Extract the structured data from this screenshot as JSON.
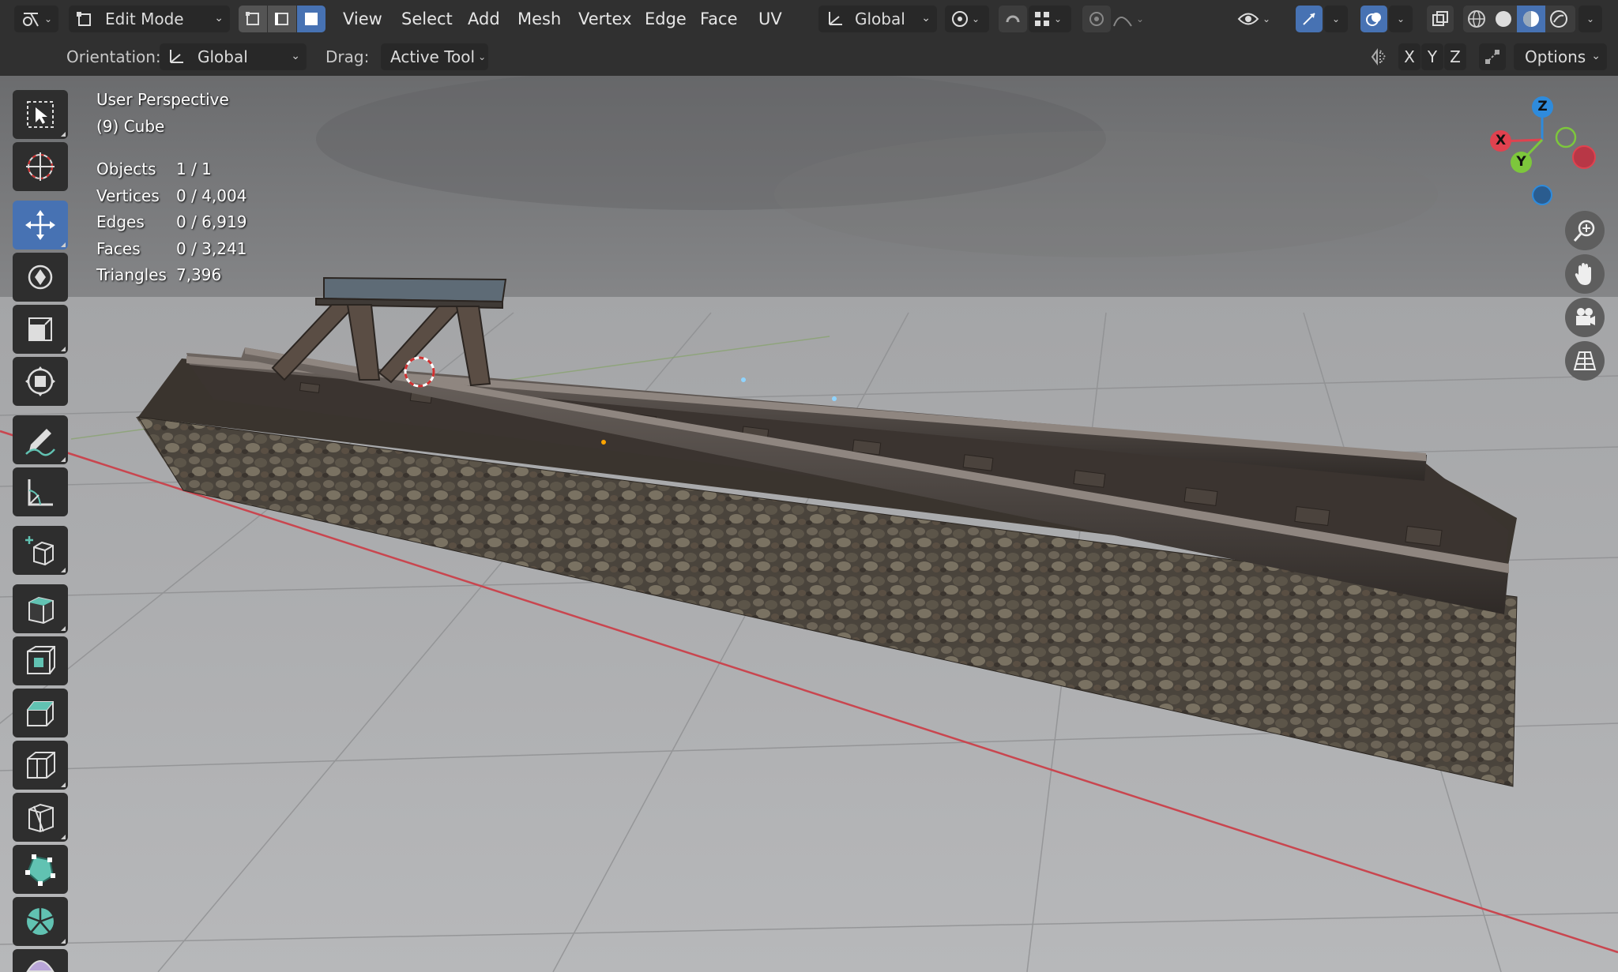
{
  "header": {
    "mode": "Edit Mode",
    "menus": [
      "View",
      "Select",
      "Add",
      "Mesh",
      "Vertex",
      "Edge",
      "Face",
      "UV"
    ],
    "transform_orientation": "Global"
  },
  "tool_settings": {
    "orientation_label": "Orientation:",
    "orientation_value": "Global",
    "drag_label": "Drag:",
    "drag_value": "Active Tool",
    "axes": [
      "X",
      "Y",
      "Z"
    ],
    "options_label": "Options"
  },
  "viewport_overlay": {
    "view_name": "User Perspective",
    "object_name": "(9) Cube",
    "stats": [
      {
        "label": "Objects",
        "value": "1 / 1"
      },
      {
        "label": "Vertices",
        "value": "0 / 4,004"
      },
      {
        "label": "Edges",
        "value": "0 / 6,919"
      },
      {
        "label": "Faces",
        "value": "0 / 3,241"
      },
      {
        "label": "Triangles",
        "value": "7,396"
      }
    ]
  },
  "gizmo": {
    "axis_x": "X",
    "axis_y": "Y",
    "axis_z": "Z",
    "colors": {
      "x": "#e0424f",
      "y": "#7dc73c",
      "z": "#2e8bdc"
    }
  },
  "toolbar": {
    "tools": [
      "select-box",
      "cursor",
      "move",
      "rotate",
      "scale",
      "transform",
      "annotate",
      "measure",
      "add-cube",
      "extrude-region",
      "inset-faces",
      "bevel",
      "loop-cut",
      "knife",
      "poly-build",
      "spin",
      "smooth"
    ]
  },
  "navigation": [
    "zoom",
    "pan",
    "camera",
    "perspective-toggle"
  ],
  "colors": {
    "header_bg": "#303030",
    "active_blue": "#4772b3",
    "button_gray": "#545454"
  }
}
